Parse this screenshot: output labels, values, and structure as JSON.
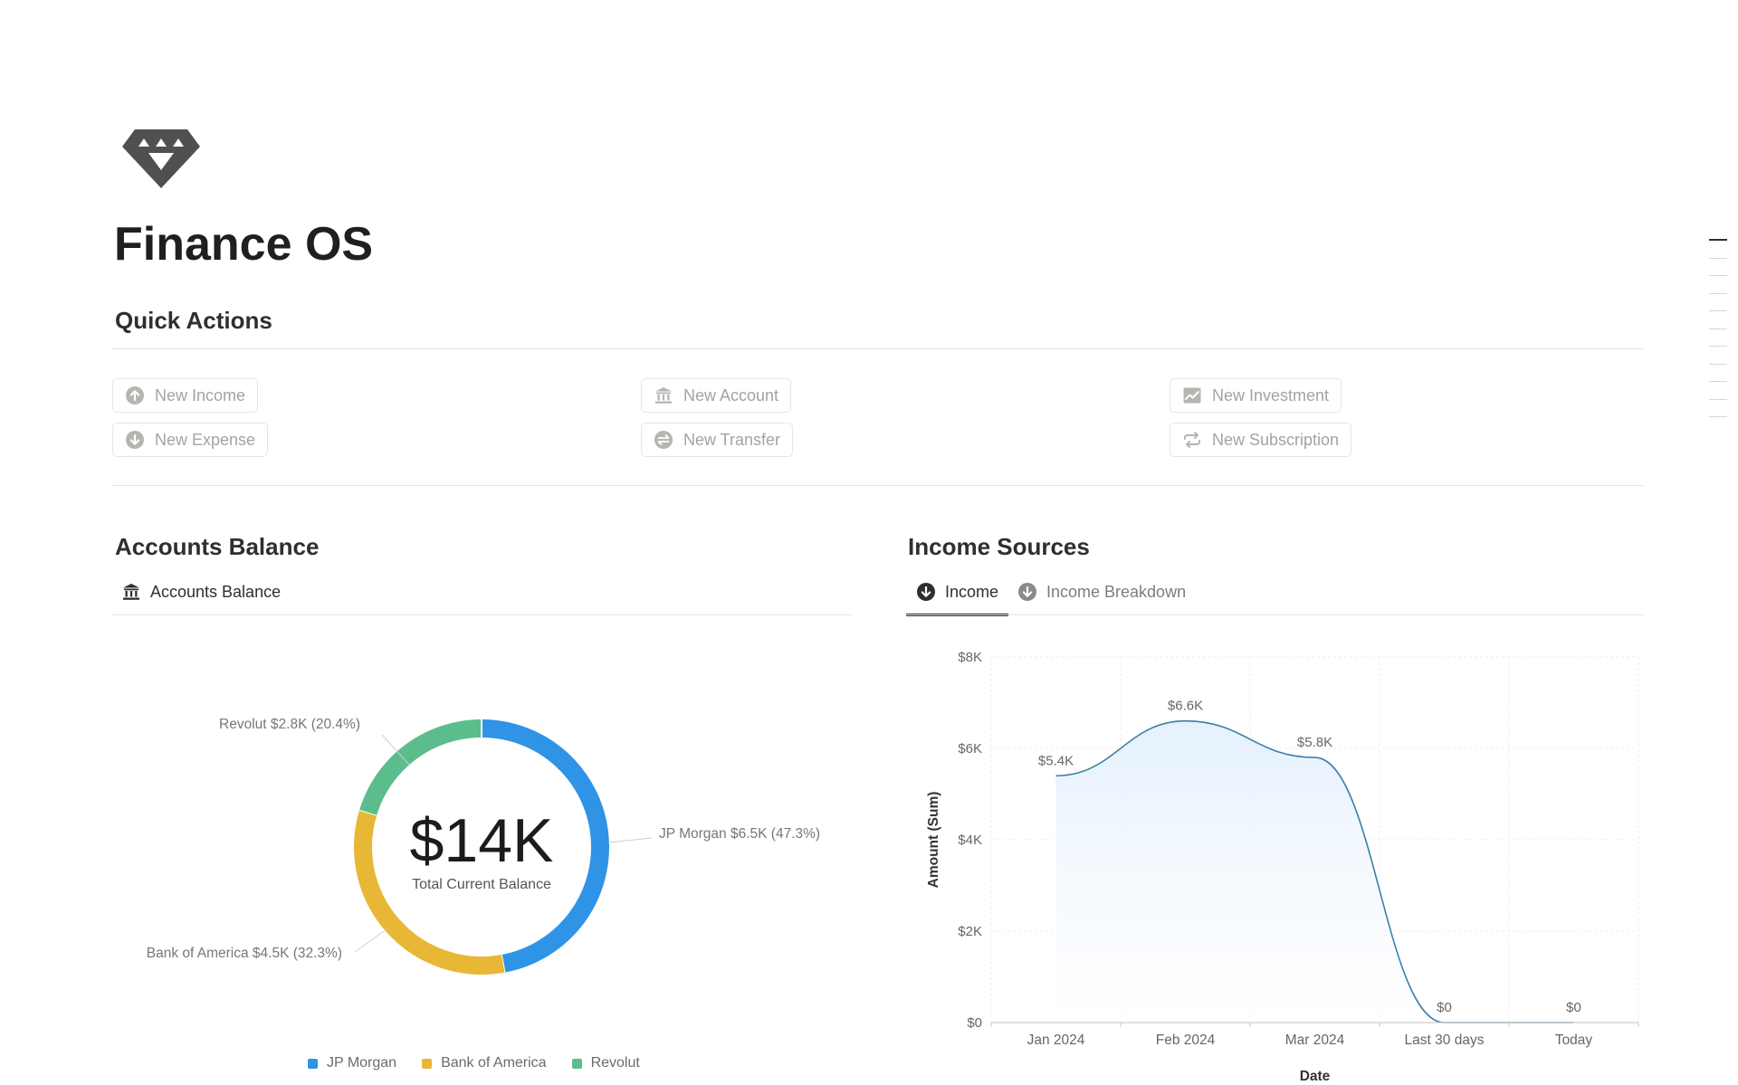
{
  "page": {
    "title": "Finance OS",
    "icon": "gem-icon"
  },
  "quick_actions": {
    "heading": "Quick Actions",
    "buttons": [
      {
        "label": "New Income",
        "icon": "arrow-up-circle-icon"
      },
      {
        "label": "New Expense",
        "icon": "arrow-down-circle-icon"
      },
      {
        "label": "New Account",
        "icon": "bank-icon"
      },
      {
        "label": "New Transfer",
        "icon": "transfer-icon"
      },
      {
        "label": "New Investment",
        "icon": "chart-icon"
      },
      {
        "label": "New Subscription",
        "icon": "repeat-icon"
      }
    ]
  },
  "accounts_balance": {
    "heading": "Accounts Balance",
    "tab_label": "Accounts Balance",
    "center_value": "$14K",
    "center_caption": "Total Current Balance"
  },
  "income_sources": {
    "heading": "Income Sources",
    "tabs": [
      {
        "label": "Income",
        "active": true
      },
      {
        "label": "Income Breakdown",
        "active": false
      }
    ]
  },
  "colors": {
    "jp_morgan": "#2f94e6",
    "bank_of_america": "#e8b735",
    "revolut": "#5bbd8c",
    "line": "#3a7fa8"
  },
  "chart_data": [
    {
      "type": "pie",
      "donut": true,
      "categories": [
        "JP Morgan",
        "Bank of America",
        "Revolut"
      ],
      "values": [
        6.5,
        4.5,
        2.8
      ],
      "value_labels": [
        "$6.5K",
        "$4.5K",
        "$2.8K"
      ],
      "percent_labels": [
        "(47.3%)",
        "(32.3%)",
        "(20.4%)"
      ],
      "unit": "K USD",
      "legend": "bottom"
    },
    {
      "type": "area",
      "categories": [
        "Jan 2024",
        "Feb 2024",
        "Mar 2024",
        "Last 30 days",
        "Today"
      ],
      "values": [
        5400,
        6600,
        5800,
        0,
        0
      ],
      "data_labels": [
        "$5.4K",
        "$6.6K",
        "$5.8K",
        "$0",
        "$0"
      ],
      "xlabel": "Date",
      "ylabel": "Amount (Sum)",
      "ylim": [
        0,
        8000
      ],
      "yticks": [
        0,
        2000,
        4000,
        6000,
        8000
      ],
      "ytick_labels": [
        "$0",
        "$2K",
        "$4K",
        "$6K",
        "$8K"
      ],
      "grid": true
    }
  ]
}
